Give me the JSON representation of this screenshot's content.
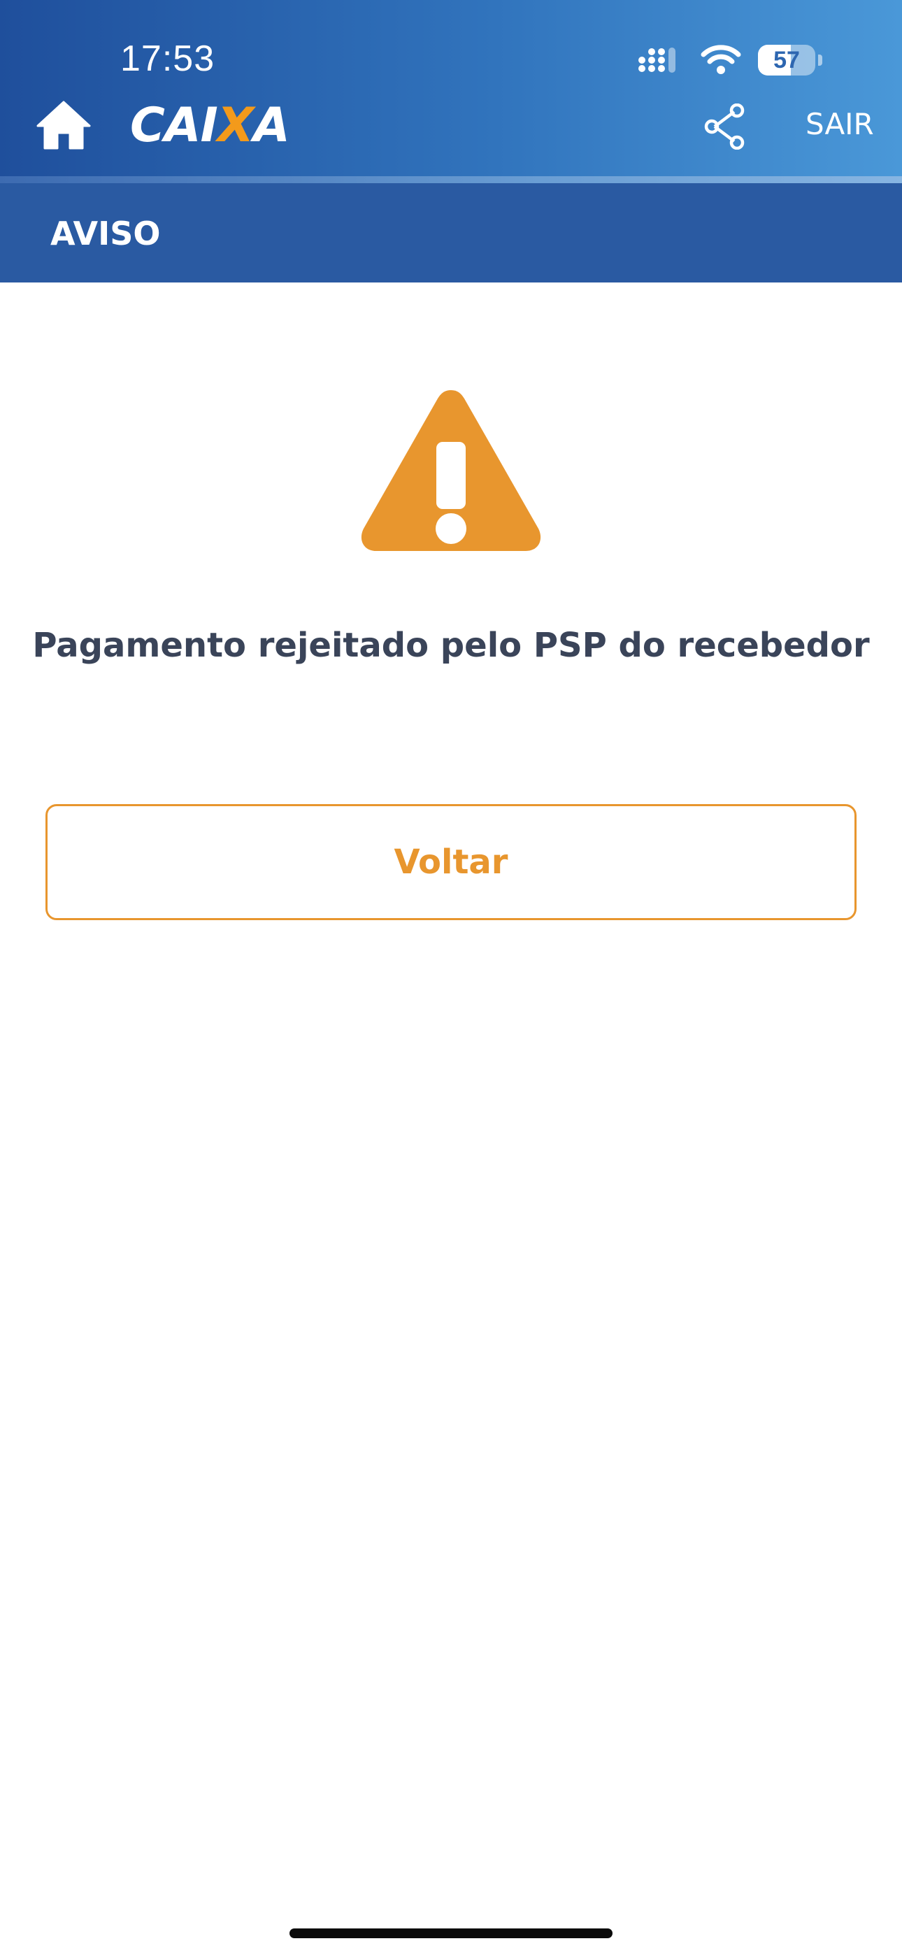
{
  "status_bar": {
    "time": "17:53",
    "battery_level": "57",
    "icons": [
      "signal-icon",
      "wifi-icon",
      "battery-icon"
    ]
  },
  "header": {
    "brand_text_before": "CAI",
    "brand_text_x": "X",
    "brand_text_after": "A",
    "exit_label": "SAIR",
    "icons": [
      "home-icon",
      "share-icon"
    ]
  },
  "page": {
    "title": "AVISO"
  },
  "notice": {
    "icon": "warning-icon",
    "message": "Pagamento rejeitado pelo PSP do recebedor"
  },
  "actions": {
    "back_label": "Voltar"
  },
  "colors": {
    "header_start": "#1f4f9c",
    "header_end": "#4a98d8",
    "title_bar": "#2a5aa2",
    "accent": "#e8962e",
    "text": "#3a4459"
  }
}
